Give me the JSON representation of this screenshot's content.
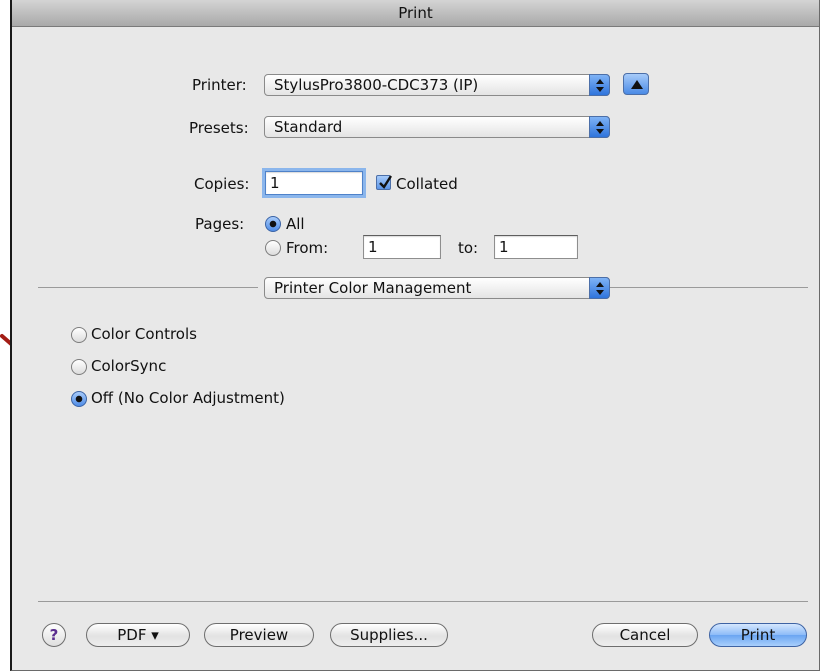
{
  "window": {
    "title": "Print"
  },
  "printer": {
    "label": "Printer:",
    "value": "StylusPro3800-CDC373 (IP)"
  },
  "presets": {
    "label": "Presets:",
    "value": "Standard"
  },
  "copies": {
    "label": "Copies:",
    "value": "1",
    "collated_label": "Collated",
    "collated": true
  },
  "pages": {
    "label": "Pages:",
    "all_label": "All",
    "from_label": "From:",
    "from_value": "1",
    "to_label": "to:",
    "to_value": "1",
    "selected": "All"
  },
  "section": {
    "value": "Printer Color Management"
  },
  "color_options": {
    "items": [
      "Color Controls",
      "ColorSync",
      "Off (No Color Adjustment)"
    ],
    "selected": "Off (No Color Adjustment)"
  },
  "footer": {
    "help_label": "?",
    "pdf_label": "PDF ▾",
    "preview_label": "Preview",
    "supplies_label": "Supplies...",
    "cancel_label": "Cancel",
    "print_label": "Print"
  },
  "colors": {
    "accent": "#4a8ae6",
    "annotation_arrow": "#a31d15",
    "dialog_bg": "#e8e8e8"
  },
  "icons": {
    "popup_arrows": "up-down-arrows-icon",
    "disclosure": "triangle-up-icon",
    "check": "checkmark-icon"
  }
}
